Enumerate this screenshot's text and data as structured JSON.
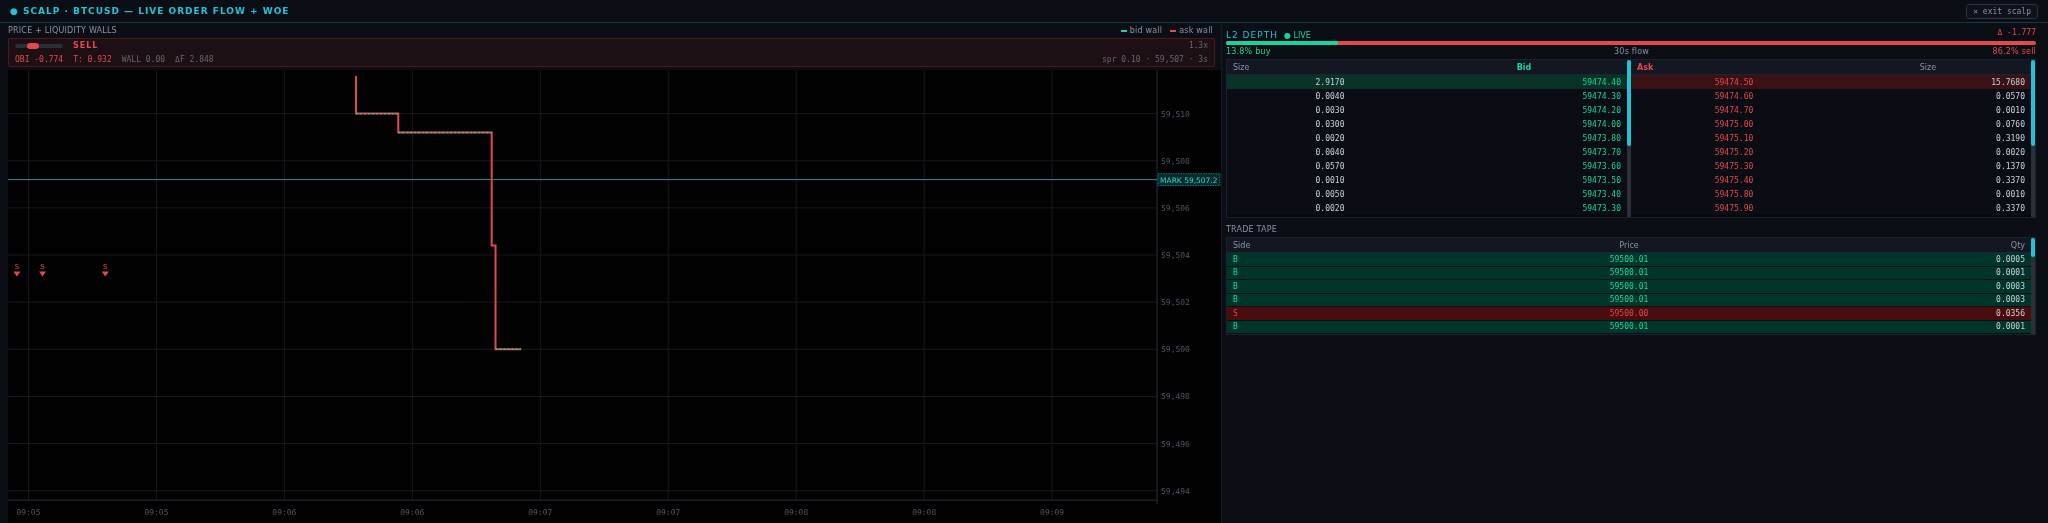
{
  "header": {
    "title": "● SCALP · BTCUSD — LIVE ORDER FLOW + WOE",
    "exit_button": "✕ exit scalp"
  },
  "price_panel": {
    "title": "PRICE + LIQUIDITY WALLS",
    "legend": [
      {
        "label": "bid wall",
        "color": "#19d49a"
      },
      {
        "label": "ask wall",
        "color": "#e5484d"
      }
    ],
    "signal": {
      "label": "SELL",
      "kind": "sell",
      "level": 0.38,
      "stats": [
        {
          "text": "OBI -0.774",
          "kind": "sell"
        },
        {
          "text": "T: 0.932",
          "kind": "sell"
        },
        {
          "text": "WALL 0.00",
          "kind": "muted"
        },
        {
          "text": "ΔF 2.848",
          "kind": "muted"
        }
      ],
      "right": [
        "1.3x",
        "spr 0.10 · 59,507 · 3s"
      ]
    },
    "chart": {
      "y_labels": [
        "59,510",
        "59,508",
        "59,506",
        "59,504",
        "59,502",
        "59,500",
        "59,498",
        "59,496",
        "59,494"
      ],
      "x_labels": [
        "09:05",
        "09:05",
        "09:06",
        "09:06",
        "09:07",
        "09:07",
        "09:08",
        "09:08",
        "09:09"
      ],
      "mark_label": "MARK 59,507.2",
      "signals": [
        "S",
        "S",
        "S"
      ]
    }
  },
  "depth_panel": {
    "title": "L2 DEPTH",
    "live_icon": "●",
    "live_label": "LIVE",
    "delta": "Δ -1.777",
    "flow": {
      "level": 0.138,
      "buy_label": "13.8% buy",
      "center_label": "30s flow",
      "sell_label": "86.2% sell"
    },
    "book": {
      "columns": [
        "Size",
        "Bid",
        "Ask",
        "Size"
      ],
      "rows": [
        {
          "highlighted": true,
          "bid": {
            "size": "2.9170",
            "price": "59474.40"
          },
          "ask": {
            "price": "59474.50",
            "size": "15.7680"
          }
        },
        {
          "highlighted": false,
          "bid": {
            "size": "0.0040",
            "price": "59474.30"
          },
          "ask": {
            "price": "59474.60",
            "size": "0.0570"
          }
        },
        {
          "highlighted": false,
          "bid": {
            "size": "0.0030",
            "price": "59474.20"
          },
          "ask": {
            "price": "59474.70",
            "size": "0.0010"
          }
        },
        {
          "highlighted": false,
          "bid": {
            "size": "0.0300",
            "price": "59474.00"
          },
          "ask": {
            "price": "59475.00",
            "size": "0.0760"
          }
        },
        {
          "highlighted": false,
          "bid": {
            "size": "0.0020",
            "price": "59473.80"
          },
          "ask": {
            "price": "59475.10",
            "size": "0.3190"
          }
        },
        {
          "highlighted": false,
          "bid": {
            "size": "0.0040",
            "price": "59473.70"
          },
          "ask": {
            "price": "59475.20",
            "size": "0.0020"
          }
        },
        {
          "highlighted": false,
          "bid": {
            "size": "0.0570",
            "price": "59473.60"
          },
          "ask": {
            "price": "59475.30",
            "size": "0.1370"
          }
        },
        {
          "highlighted": false,
          "bid": {
            "size": "0.0010",
            "price": "59473.50"
          },
          "ask": {
            "price": "59475.40",
            "size": "0.3370"
          }
        },
        {
          "highlighted": false,
          "bid": {
            "size": "0.0050",
            "price": "59473.40"
          },
          "ask": {
            "price": "59475.80",
            "size": "0.0010"
          }
        },
        {
          "highlighted": false,
          "bid": {
            "size": "0.0020",
            "price": "59473.30"
          },
          "ask": {
            "price": "59475.90",
            "size": "0.3370"
          }
        }
      ]
    },
    "tape": {
      "title": "TRADE TAPE",
      "columns": [
        "Side",
        "Price",
        "Qty"
      ],
      "rows": [
        {
          "kind": "buy",
          "side": "B",
          "price": "59500.01",
          "qty": "0.0005"
        },
        {
          "kind": "buy",
          "side": "B",
          "price": "59500.01",
          "qty": "0.0001"
        },
        {
          "kind": "buy",
          "side": "B",
          "price": "59500.01",
          "qty": "0.0003"
        },
        {
          "kind": "buy",
          "side": "B",
          "price": "59500.01",
          "qty": "0.0003"
        },
        {
          "kind": "sell",
          "side": "S",
          "price": "59500.00",
          "qty": "0.0356"
        },
        {
          "kind": "buy",
          "side": "B",
          "price": "59500.01",
          "qty": "0.0001"
        }
      ]
    }
  }
}
